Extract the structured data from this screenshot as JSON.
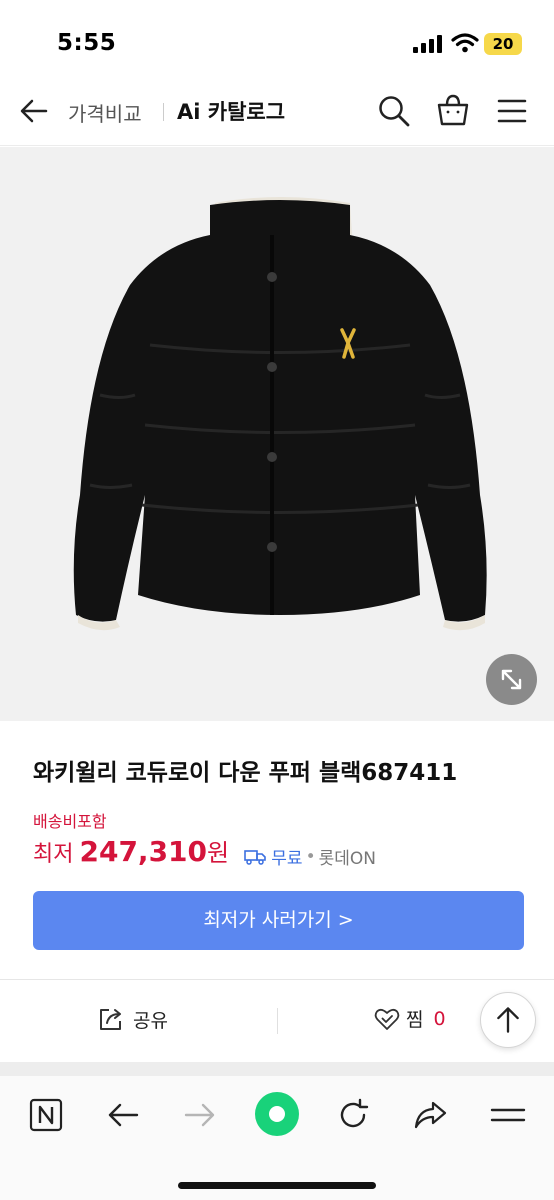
{
  "status_bar": {
    "time": "5:55",
    "battery": "20",
    "battery_color": "#f6d84a"
  },
  "header": {
    "price_compare": "가격비교",
    "catalog": "Ai 카탈로그",
    "icons": [
      "back-arrow-icon",
      "search-icon",
      "shopping-bag-icon",
      "hamburger-menu-icon"
    ]
  },
  "product": {
    "title": "와키윌리 코듀로이 다운 푸퍼 블랙687411",
    "shipping_included": "배송비포함",
    "price_label": "최저",
    "price": "247,310",
    "price_unit": "원",
    "free_shipping": "무료",
    "seller": "롯데ON",
    "buy_button": "최저가 사러가기 >",
    "accent_color": "#d4143b",
    "button_color": "#5b87f0"
  },
  "actions": {
    "share": "공유",
    "zzim": "찜",
    "zzim_count": "0"
  },
  "bottom_bar": {
    "icons": [
      "naver-n-icon",
      "back-icon",
      "forward-icon",
      "green-dot-icon",
      "reload-icon",
      "share-icon",
      "menu-icon"
    ]
  }
}
